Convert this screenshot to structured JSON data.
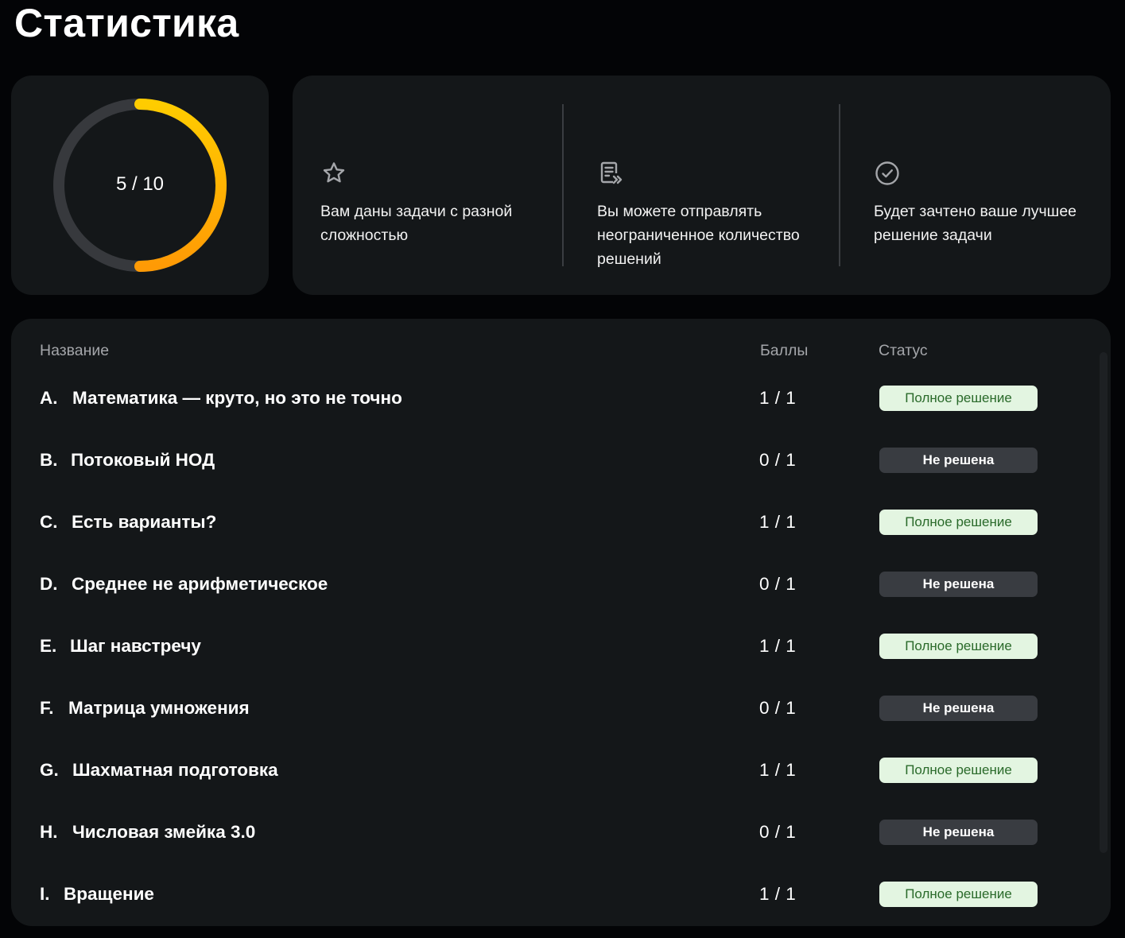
{
  "page": {
    "title": "Статистика"
  },
  "progress": {
    "solved": 5,
    "total": 10,
    "label": "5 / 10",
    "colors": {
      "track": "#37393d",
      "arc_start": "#ffcc00",
      "arc_end": "#ff9a05"
    }
  },
  "info": {
    "items": [
      {
        "icon": "star-icon",
        "text": "Вам даны задачи с разной сложностью"
      },
      {
        "icon": "document-send-icon",
        "text": "Вы можете отправлять неограниченное количество решений"
      },
      {
        "icon": "check-circle-icon",
        "text": "Будет зачтено ваше лучшее решение задачи"
      }
    ]
  },
  "table": {
    "headers": {
      "name": "Название",
      "score": "Баллы",
      "status": "Статус"
    },
    "rows": [
      {
        "letter": "A.",
        "name": "Математика — круто, но это не точно",
        "score": "1 / 1",
        "status": "Полное решение",
        "solved": true
      },
      {
        "letter": "B.",
        "name": "Потоковый НОД",
        "score": "0 / 1",
        "status": "Не решена",
        "solved": false
      },
      {
        "letter": "C.",
        "name": "Есть варианты?",
        "score": "1 / 1",
        "status": "Полное решение",
        "solved": true
      },
      {
        "letter": "D.",
        "name": "Среднее не арифметическое",
        "score": "0 / 1",
        "status": "Не решена",
        "solved": false
      },
      {
        "letter": "E.",
        "name": "Шаг навстречу",
        "score": "1 / 1",
        "status": "Полное решение",
        "solved": true
      },
      {
        "letter": "F.",
        "name": "Матрица умножения",
        "score": "0 / 1",
        "status": "Не решена",
        "solved": false
      },
      {
        "letter": "G.",
        "name": "Шахматная подготовка",
        "score": "1 / 1",
        "status": "Полное решение",
        "solved": true
      },
      {
        "letter": "H.",
        "name": "Числовая змейка 3.0",
        "score": "0 / 1",
        "status": "Не решена",
        "solved": false
      },
      {
        "letter": "I.",
        "name": "Вращение",
        "score": "1 / 1",
        "status": "Полное решение",
        "solved": true
      }
    ]
  },
  "colors": {
    "background": "#030406",
    "card": "#141719",
    "badge_solved_bg": "#e3f5e1",
    "badge_solved_text": "#2a6a2a",
    "badge_unsolved_bg": "#393c41",
    "badge_unsolved_text": "#ffffff"
  }
}
